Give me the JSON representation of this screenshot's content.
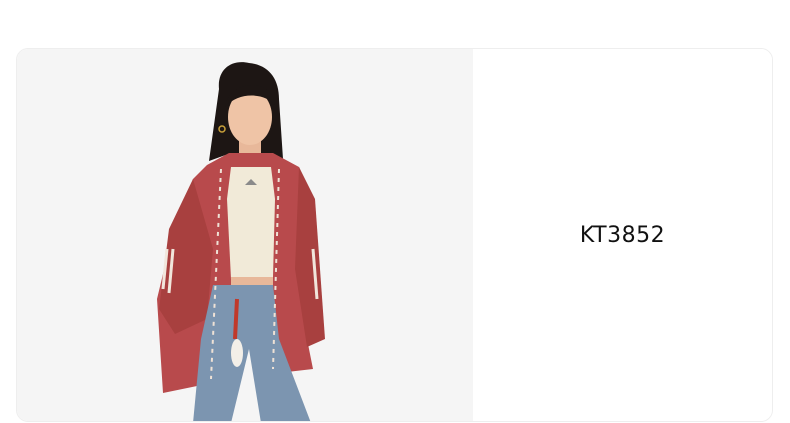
{
  "product": {
    "code": "KT3852",
    "image": "model-red-knit-cardigan-photo"
  },
  "colors": {
    "image_background": "#f5f5f5",
    "card_background": "#ffffff",
    "cardigan": "#b84a4c",
    "denim": "#7c95b0",
    "top": "#f1ead8"
  }
}
